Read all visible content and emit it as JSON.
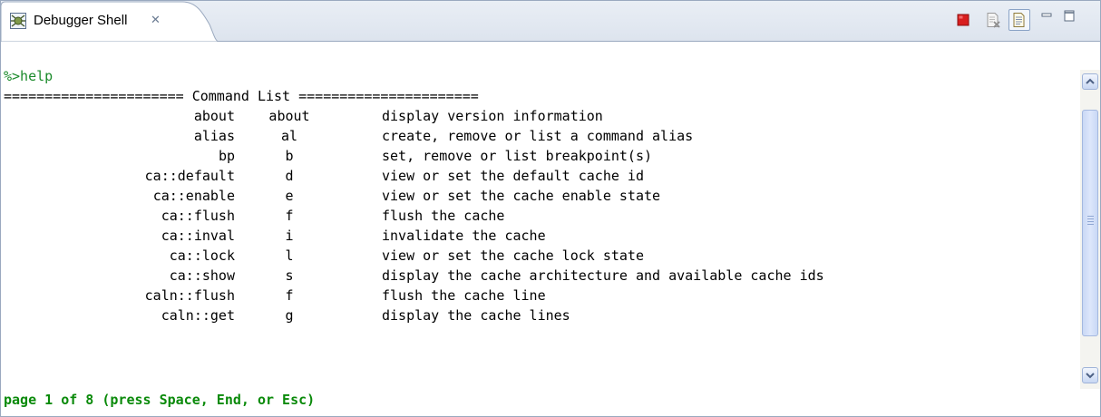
{
  "tab": {
    "title": "Debugger Shell",
    "icon": "debugger-shell-icon",
    "close_glyph": "✕"
  },
  "toolbar": {
    "icons": [
      "terminate-icon",
      "clear-console-icon",
      "scroll-lock-icon",
      "minimize-icon",
      "maximize-icon"
    ],
    "terminate_color": "#d81e1e"
  },
  "console": {
    "prompt": "%>help",
    "header": "====================== Command List ======================",
    "commands": [
      {
        "name": "about",
        "alias": "about",
        "desc": "display version information"
      },
      {
        "name": "alias",
        "alias": "al",
        "desc": "create, remove or list a command alias"
      },
      {
        "name": "bp",
        "alias": "b",
        "desc": "set, remove or list breakpoint(s)"
      },
      {
        "name": "ca::default",
        "alias": "d",
        "desc": "view or set the default cache id"
      },
      {
        "name": "ca::enable",
        "alias": "e",
        "desc": "view or set the cache enable state"
      },
      {
        "name": "ca::flush",
        "alias": "f",
        "desc": "flush the cache"
      },
      {
        "name": "ca::inval",
        "alias": "i",
        "desc": "invalidate the cache"
      },
      {
        "name": "ca::lock",
        "alias": "l",
        "desc": "view or set the cache lock state"
      },
      {
        "name": "ca::show",
        "alias": "s",
        "desc": "display the cache architecture and available cache ids"
      },
      {
        "name": "caln::flush",
        "alias": "f",
        "desc": "flush the cache line"
      },
      {
        "name": "caln::get",
        "alias": "g",
        "desc": "display the cache lines"
      }
    ],
    "status": "page 1 of 8 (press Space, End, or Esc)"
  },
  "colors": {
    "prompt": "#1a8a2a",
    "status": "#0a8a0a",
    "frame_border": "#9aa9bf"
  }
}
